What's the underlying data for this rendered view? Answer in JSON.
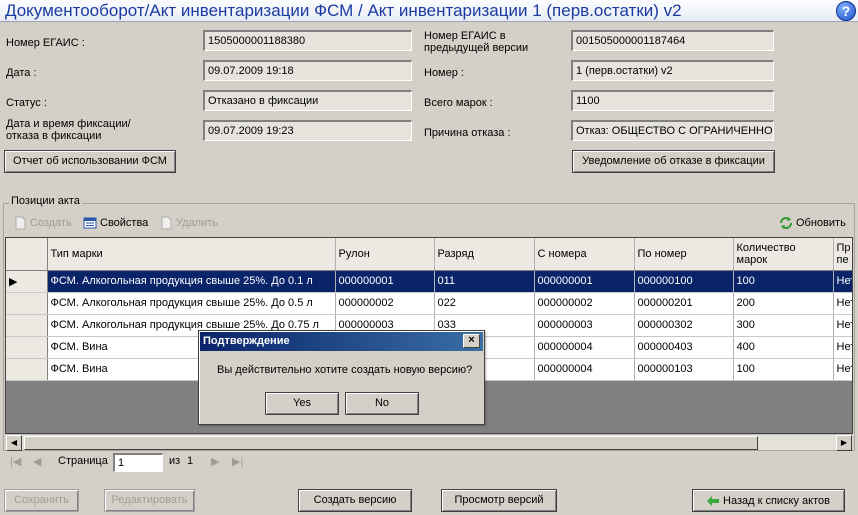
{
  "window": {
    "title": "Документооборот/Акт инвентаризации ФСМ / Акт инвентаризации  1 (перв.остатки) v2",
    "help_icon": "?"
  },
  "form": {
    "left": [
      {
        "label_lines": [
          "Номер ЕГАИС :"
        ],
        "value": "1505000001188380"
      },
      {
        "label_lines": [
          "Дата :"
        ],
        "value": "09.07.2009 19:18"
      },
      {
        "label_lines": [
          "Статус :"
        ],
        "value": "Отказано в фиксации"
      },
      {
        "label_lines": [
          "Дата и время фиксации/",
          "отказа в фиксации"
        ],
        "value": "09.07.2009 19:23"
      }
    ],
    "right": [
      {
        "label_lines": [
          "Номер ЕГАИС в",
          "предыдущей версии"
        ],
        "value": "001505000001187464"
      },
      {
        "label_lines": [
          "Номер :"
        ],
        "value": "1 (перв.остатки) v2"
      },
      {
        "label_lines": [
          "Всего марок :"
        ],
        "value": "1100"
      },
      {
        "label_lines": [
          "Причина отказа :"
        ],
        "value": "Отказ: ОБЩЕСТВО С ОГРАНИЧЕННОЙ ОТВЕТСТВЕННОСТЬЮ"
      }
    ],
    "report_button": "Отчет об использовании ФСМ",
    "notice_button": "Уведомление об отказе в фиксации"
  },
  "positions": {
    "group_title": "Позиции акта",
    "toolbar": {
      "create": "Создать",
      "properties": "Свойства",
      "delete": "Удалить",
      "refresh": "Обновить"
    },
    "columns": [
      {
        "lines": [
          "Тип марки"
        ]
      },
      {
        "lines": [
          "Рулон"
        ]
      },
      {
        "lines": [
          "Разряд"
        ]
      },
      {
        "lines": [
          "С номера"
        ]
      },
      {
        "lines": [
          "По номер"
        ]
      },
      {
        "lines": [
          "Количество",
          "марок"
        ]
      },
      {
        "lines": [
          "Пр",
          "пе"
        ]
      }
    ],
    "rows": [
      {
        "cells": [
          "ФСМ. Алкогольная продукция свыше 25%. До 0.1 л",
          "000000001",
          "011",
          "000000001",
          "000000100",
          "100",
          "Нет"
        ],
        "selected": true
      },
      {
        "cells": [
          "ФСМ. Алкогольная продукция свыше 25%. До 0.5 л",
          "000000002",
          "022",
          "000000002",
          "000000201",
          "200",
          "Нет"
        ],
        "selected": false
      },
      {
        "cells": [
          "ФСМ. Алкогольная продукция свыше 25%. До 0.75 л",
          "000000003",
          "033",
          "000000003",
          "000000302",
          "300",
          "Нет"
        ],
        "selected": false
      },
      {
        "cells": [
          "ФСМ. Вина",
          "",
          "",
          "000000004",
          "000000403",
          "400",
          "Нет"
        ],
        "selected": false
      },
      {
        "cells": [
          "ФСМ. Вина",
          "",
          "",
          "000000004",
          "000000103",
          "100",
          "Нет"
        ],
        "selected": false
      }
    ],
    "pager": {
      "page_label": "Страница",
      "page_value": "1",
      "of_label": "из",
      "total": "1"
    }
  },
  "bottom_buttons": {
    "save": "Сохранить",
    "edit": "Редактировать",
    "create_version": "Создать версию",
    "view_versions": "Просмотр версий",
    "back": "Назад к списку актов"
  },
  "dialog": {
    "title": "Подтверждение",
    "message": "Вы действительно хотите создать новую версию?",
    "yes": "Yes",
    "no": "No"
  },
  "colors": {
    "title_text": "#1a3ba3",
    "selection": "#0a246a",
    "window_bg": "#d4d0c8"
  }
}
